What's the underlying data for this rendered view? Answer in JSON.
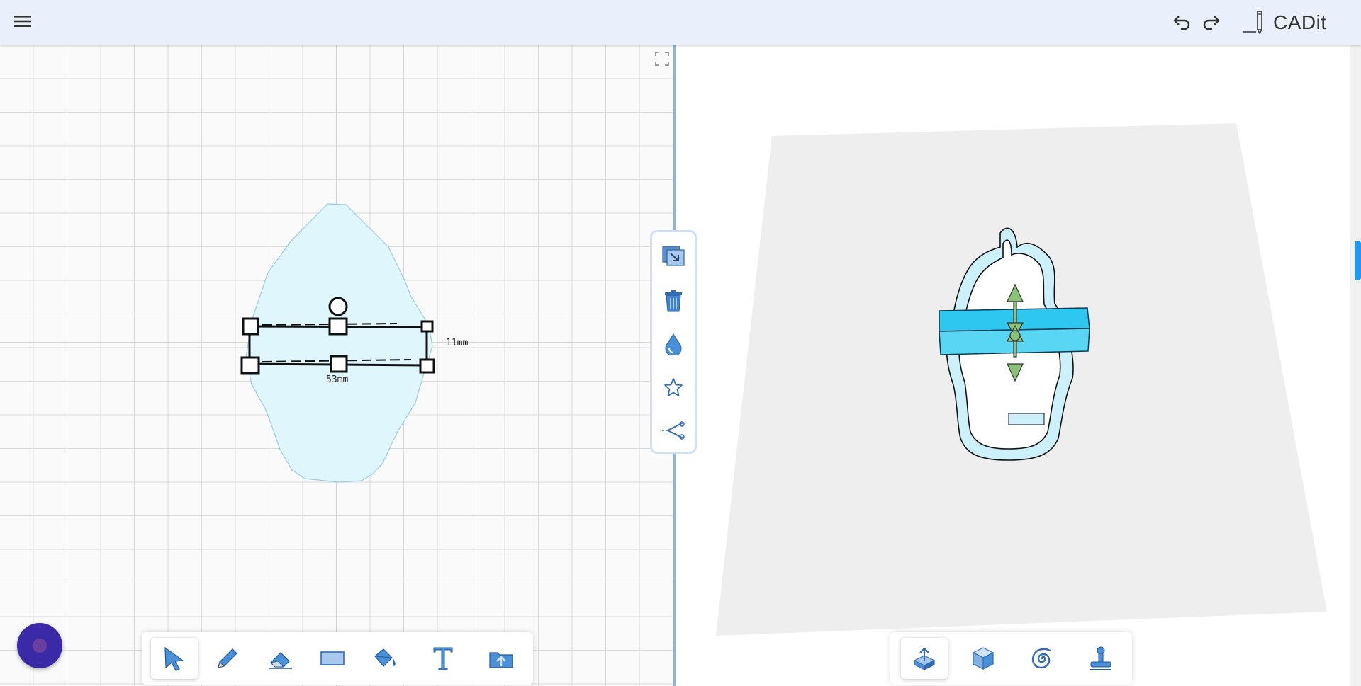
{
  "app": {
    "title": "CADit",
    "accent": "#2196f3",
    "topbar_bg": "#e9f0fb"
  },
  "topbar": {
    "menu_icon": "hamburger-menu-icon",
    "undo_icon": "undo-icon",
    "redo_icon": "redo-icon",
    "logo_icon": "pencil-logo-icon"
  },
  "sketch": {
    "shape_fill": "#dff6fc",
    "dimensions": {
      "height": "11mm",
      "width": "53mm"
    }
  },
  "context_toolbar": [
    {
      "name": "copy-layer-icon"
    },
    {
      "name": "trash-icon"
    },
    {
      "name": "droplet-icon"
    },
    {
      "name": "star-icon"
    },
    {
      "name": "scissors-icon"
    }
  ],
  "draw_toolbar": [
    {
      "name": "select-arrow-icon",
      "active": true
    },
    {
      "name": "pencil-icon",
      "active": false
    },
    {
      "name": "eraser-icon",
      "active": false
    },
    {
      "name": "rectangle-icon",
      "active": false
    },
    {
      "name": "paint-bucket-icon",
      "active": false
    },
    {
      "name": "text-icon",
      "active": false
    },
    {
      "name": "folder-upload-icon",
      "active": false
    }
  ],
  "model_toolbar": [
    {
      "name": "extrude-icon",
      "active": true
    },
    {
      "name": "cube-icon",
      "active": false
    },
    {
      "name": "spiral-icon",
      "active": false
    },
    {
      "name": "stamp-icon",
      "active": false
    }
  ],
  "viewport": {
    "plane_color": "#eeeeee",
    "cutter_fill": "#ccf1fb",
    "selection_band": "#2ec7ef",
    "handle_color": "#8bc477"
  }
}
